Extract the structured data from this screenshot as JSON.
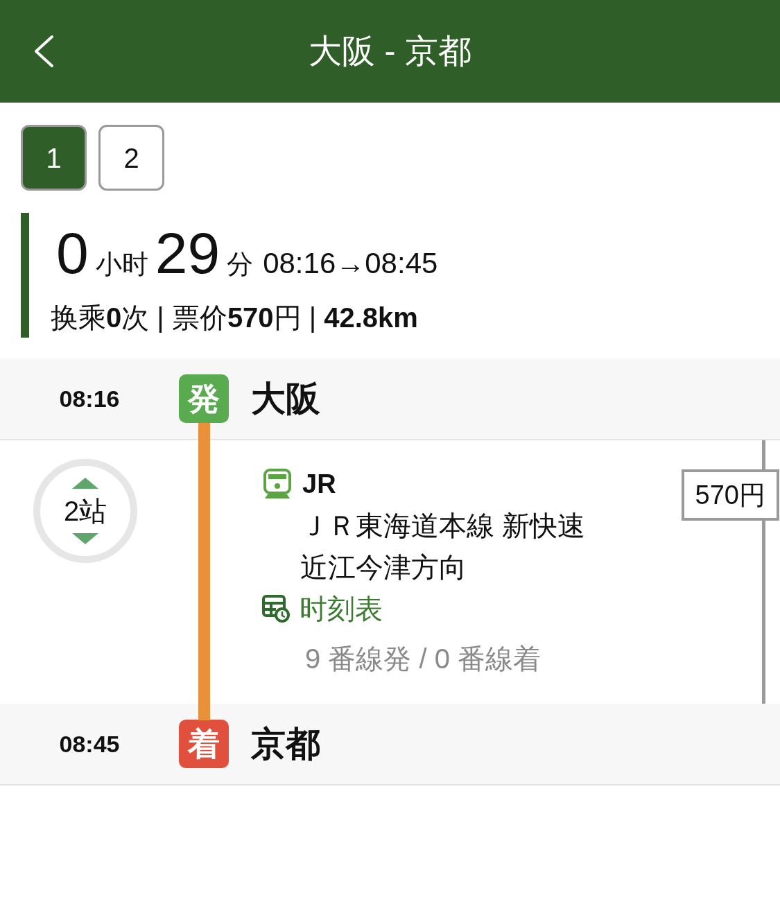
{
  "header": {
    "title": "大阪 - 京都"
  },
  "route_tabs": [
    {
      "label": "1",
      "selected": true
    },
    {
      "label": "2",
      "selected": false
    }
  ],
  "summary": {
    "hours": "0",
    "hours_unit": "小时",
    "minutes": "29",
    "minutes_unit": "分",
    "time_range": "08:16→08:45",
    "details": "换乘**0**次 | 票价**570**円 | **42.8km**"
  },
  "timeline": [
    {
      "kind": "stop",
      "time": "08:16",
      "marker": "発",
      "color": "#5aab50",
      "station": "大阪"
    },
    {
      "kind": "segment",
      "color": "#e8913a",
      "stop_count": "2站",
      "operator": "JR",
      "line_name": "ＪＲ東海道本線 新快速",
      "direction": "近江今津方向",
      "timetable_link": "时刻表",
      "platforms": "9 番線発 / 0 番線着",
      "fare": "570円"
    },
    {
      "kind": "stop",
      "time": "08:45",
      "marker": "着",
      "color": "#e0503c",
      "station": "京都"
    }
  ]
}
